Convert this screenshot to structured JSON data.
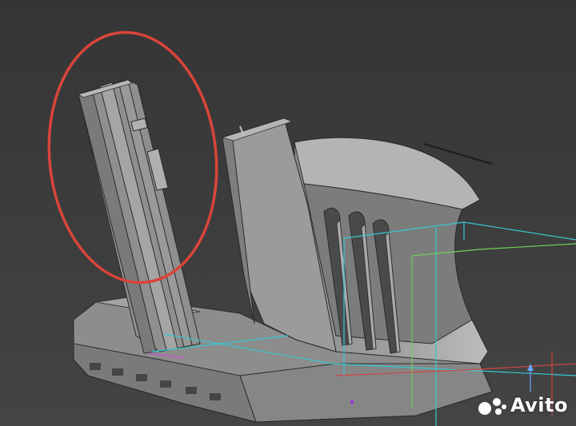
{
  "viewport": {
    "background": "#3a3a3a",
    "highlight_color": "#d9453a",
    "bbox_cyan_color": "#37c8d2",
    "bbox_green_color": "#6fcf57",
    "bbox_red_color": "#d24646",
    "axis_blue_color": "#6ba7ff",
    "model_color": "#9a9a9a"
  },
  "watermark": {
    "text": "Avito",
    "icon": "avito-logo-icon"
  }
}
